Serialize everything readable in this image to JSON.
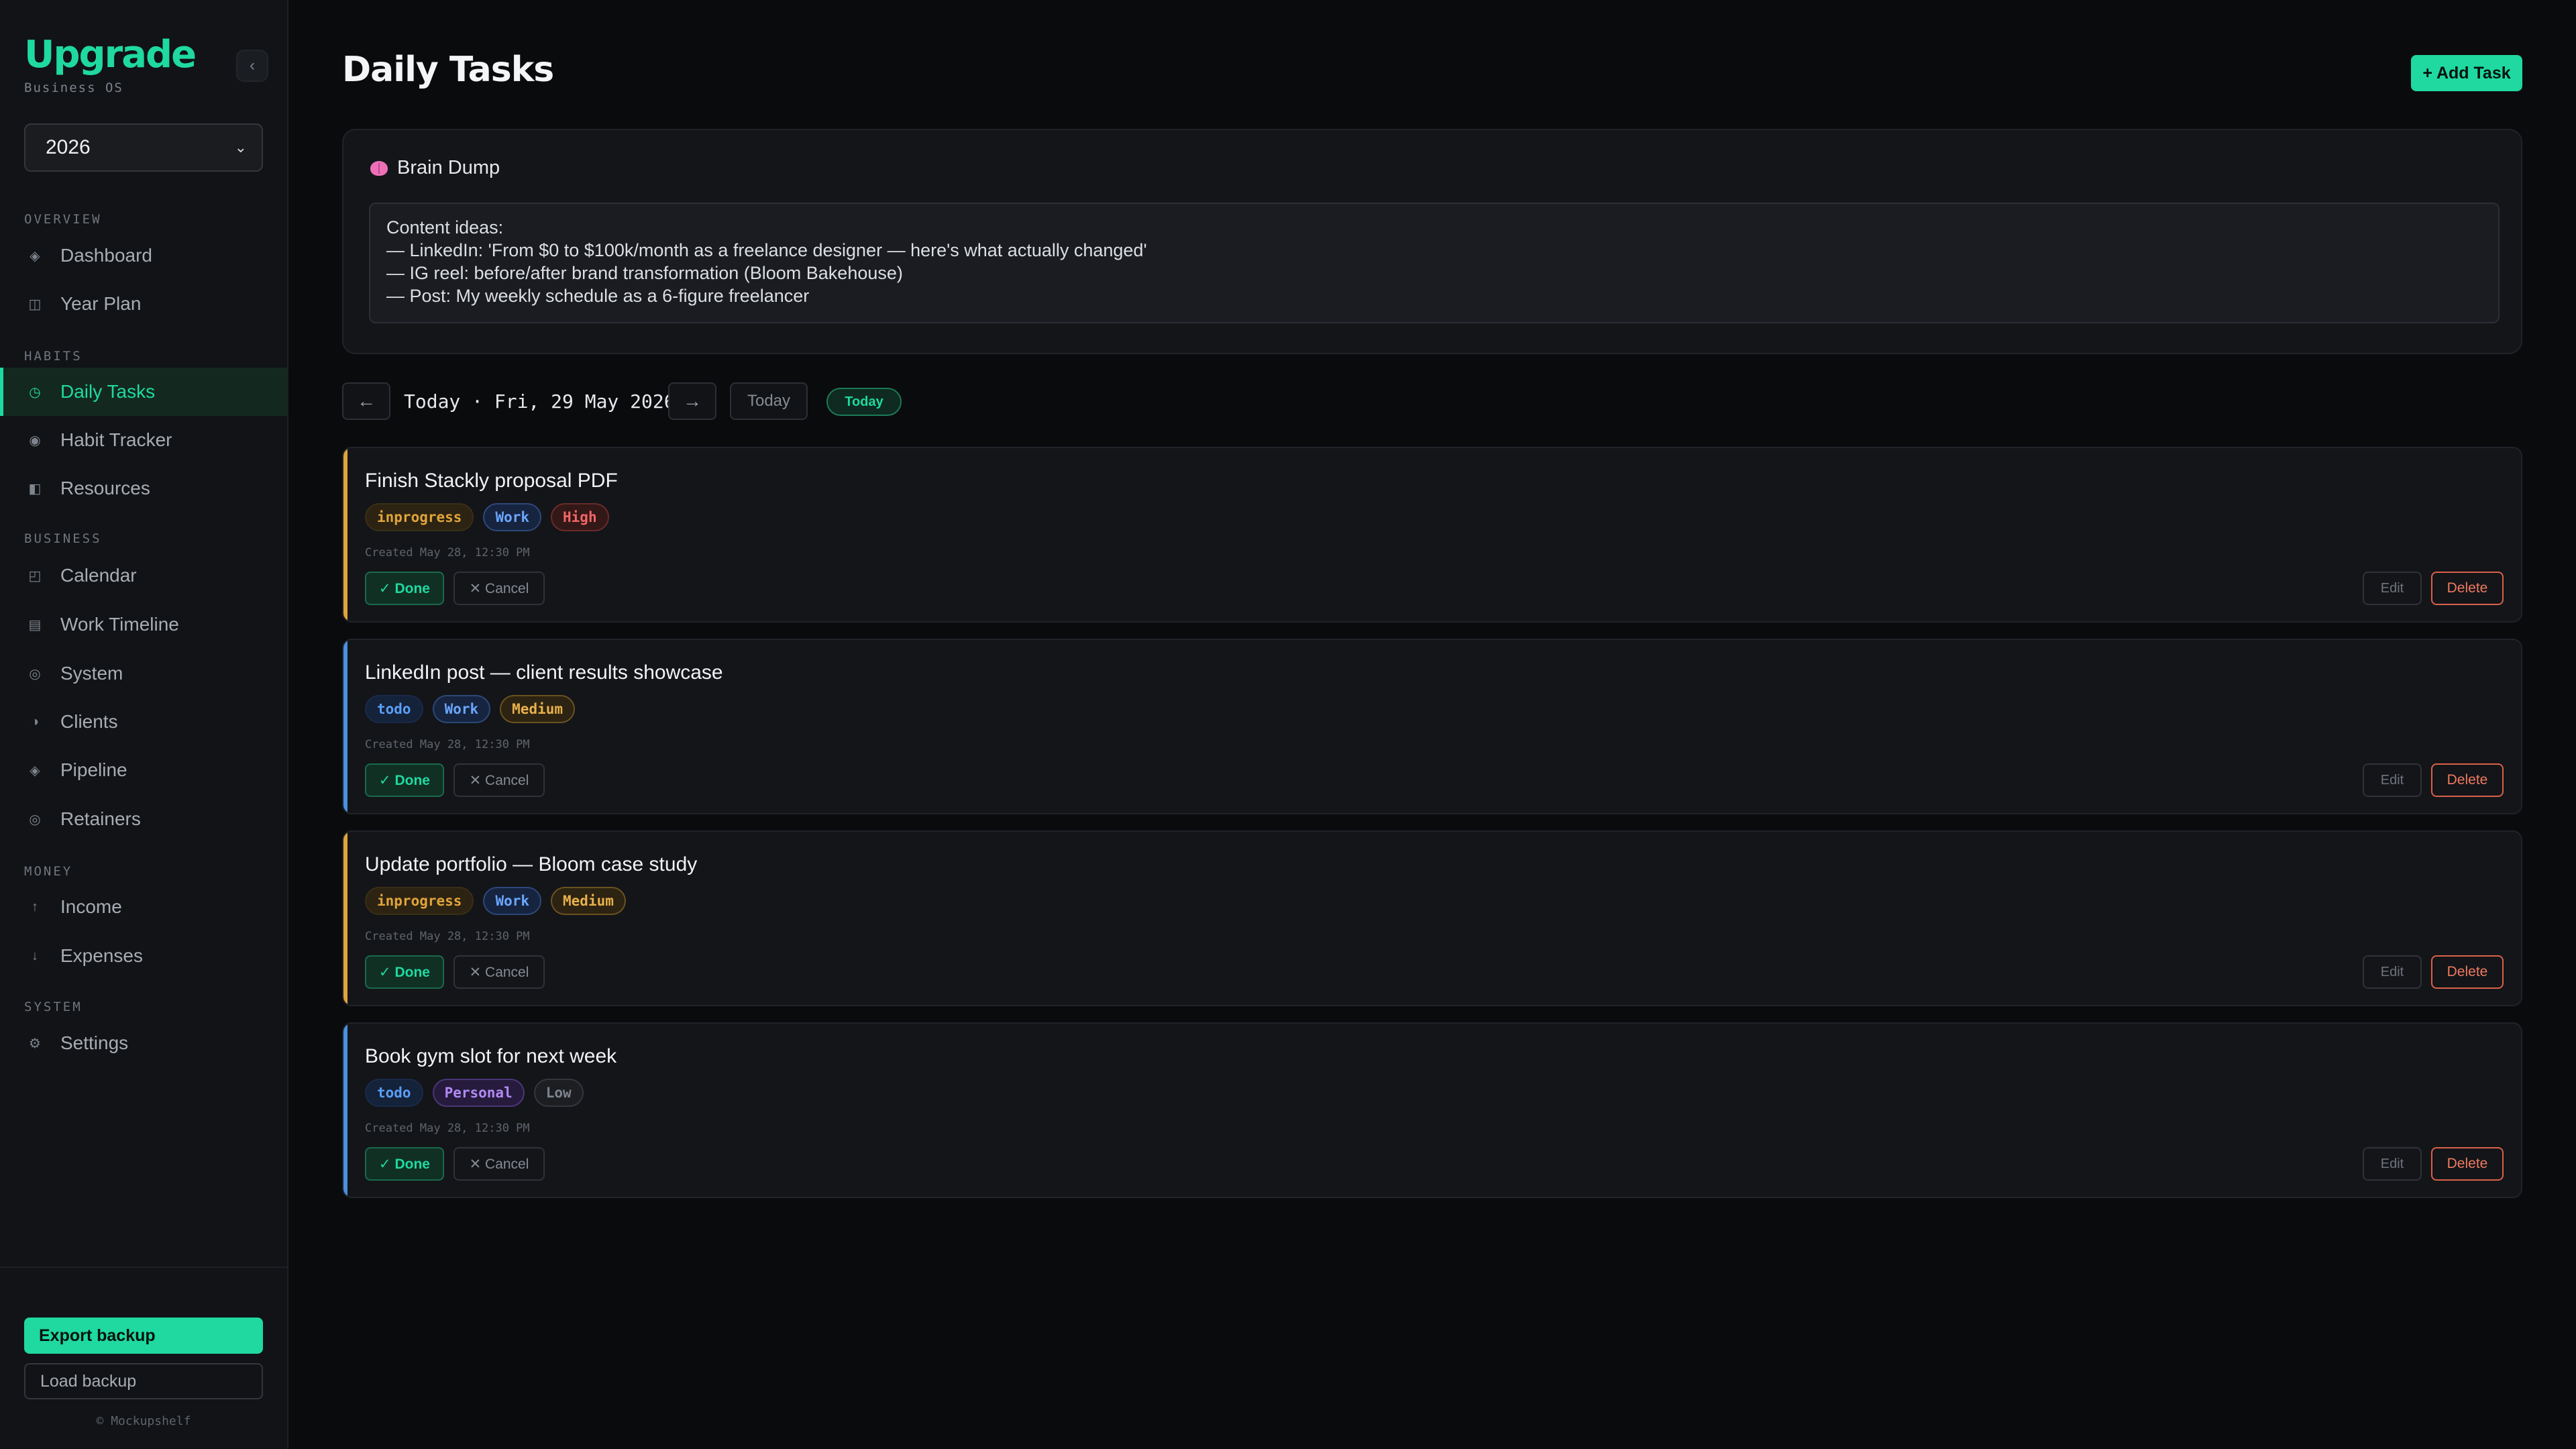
{
  "brand": {
    "name": "Upgrade",
    "subtitle": "Business OS",
    "collapse_icon": "‹"
  },
  "year_select": {
    "value": "2026"
  },
  "nav": {
    "sections": [
      {
        "label": "OVERVIEW"
      },
      {
        "label": "HABITS"
      },
      {
        "label": "BUSINESS"
      },
      {
        "label": "MONEY"
      },
      {
        "label": "SYSTEM"
      }
    ],
    "items": [
      {
        "label": "Dashboard",
        "icon": "◈"
      },
      {
        "label": "Year Plan",
        "icon": "◫"
      },
      {
        "label": "Daily Tasks",
        "icon": "◷"
      },
      {
        "label": "Habit Tracker",
        "icon": "◉"
      },
      {
        "label": "Resources",
        "icon": "◧"
      },
      {
        "label": "Calendar",
        "icon": "◰"
      },
      {
        "label": "Work Timeline",
        "icon": "▤"
      },
      {
        "label": "System",
        "icon": "◎"
      },
      {
        "label": "Clients",
        "icon": "◑"
      },
      {
        "label": "Pipeline",
        "icon": "◈"
      },
      {
        "label": "Retainers",
        "icon": "◎"
      },
      {
        "label": "Income",
        "icon": "↑"
      },
      {
        "label": "Expenses",
        "icon": "↓"
      },
      {
        "label": "Settings",
        "icon": "⚙"
      }
    ]
  },
  "footer": {
    "export_label": "Export backup",
    "load_label": "Load backup",
    "copyright": "© Mockupshelf"
  },
  "page": {
    "title": "Daily Tasks",
    "add_task_label": "+ Add Task"
  },
  "brain_dump": {
    "title": "Brain Dump",
    "text": "Content ideas:\n— LinkedIn: 'From $0 to $100k/month as a freelance designer — here's what actually changed'\n— IG reel: before/after brand transformation (Bloom Bakehouse)\n— Post: My weekly schedule as a 6-figure freelancer"
  },
  "date_nav": {
    "prev": "←",
    "next": "→",
    "label": "Today · Fri, 29 May 2026",
    "today_button": "Today",
    "today_badge": "Today"
  },
  "tasks": [
    {
      "title": "Finish Stackly proposal PDF",
      "status": "inprogress",
      "category": "Work",
      "priority": "High",
      "created": "Created May 28, 12:30 PM",
      "accent": "#e0a53a"
    },
    {
      "title": "LinkedIn post — client results showcase",
      "status": "todo",
      "category": "Work",
      "priority": "Medium",
      "created": "Created May 28, 12:30 PM",
      "accent": "#4a90e2"
    },
    {
      "title": "Update portfolio — Bloom case study",
      "status": "inprogress",
      "category": "Work",
      "priority": "Medium",
      "created": "Created May 28, 12:30 PM",
      "accent": "#e0a53a"
    },
    {
      "title": "Book gym slot for next week",
      "status": "todo",
      "category": "Personal",
      "priority": "Low",
      "created": "Created May 28, 12:30 PM",
      "accent": "#4a90e2"
    }
  ],
  "task_actions": {
    "done": "✓ Done",
    "cancel": "✕ Cancel",
    "edit": "Edit",
    "delete": "Delete"
  },
  "colors": {
    "accent": "#1fd9a0",
    "background": "#0a0b0d",
    "sidebar": "#111316"
  }
}
